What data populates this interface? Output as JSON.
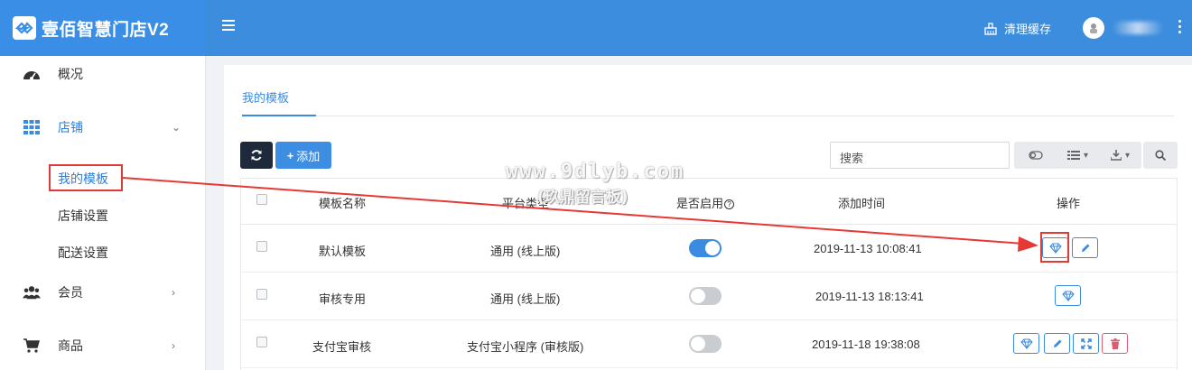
{
  "app": {
    "title": "壹佰智慧门店V2"
  },
  "header": {
    "clear_cache": "清理缓存"
  },
  "sidebar": {
    "items": [
      {
        "label": "概况"
      },
      {
        "label": "店铺"
      },
      {
        "label": "会员"
      },
      {
        "label": "商品"
      }
    ],
    "sub_items": [
      {
        "label": "我的模板"
      },
      {
        "label": "店铺设置"
      },
      {
        "label": "配送设置"
      }
    ]
  },
  "main": {
    "tab": "我的模板",
    "add_label": "添加",
    "search_placeholder": "搜索"
  },
  "table": {
    "headers": [
      "模板名称",
      "平台类型",
      "是否启用",
      "添加时间",
      "操作"
    ],
    "rows": [
      {
        "name": "默认模板",
        "platform": "通用 (线上版)",
        "enabled": true,
        "time": "2019-11-13 10:08:41"
      },
      {
        "name": "审核专用",
        "platform": "通用 (线上版)",
        "enabled": false,
        "time": "2019-11-13 18:13:41"
      },
      {
        "name": "支付宝审核",
        "platform": "支付宝小程序 (审核版)",
        "enabled": false,
        "time": "2019-11-18 19:38:08"
      }
    ]
  },
  "watermark": {
    "line1": "www.9dlyb.com",
    "line2": "(玖鼎留言板)"
  },
  "colors": {
    "primary": "#3c8dde",
    "annotation": "#e53935",
    "dark": "#1e2a3b",
    "danger": "#e05a73"
  }
}
